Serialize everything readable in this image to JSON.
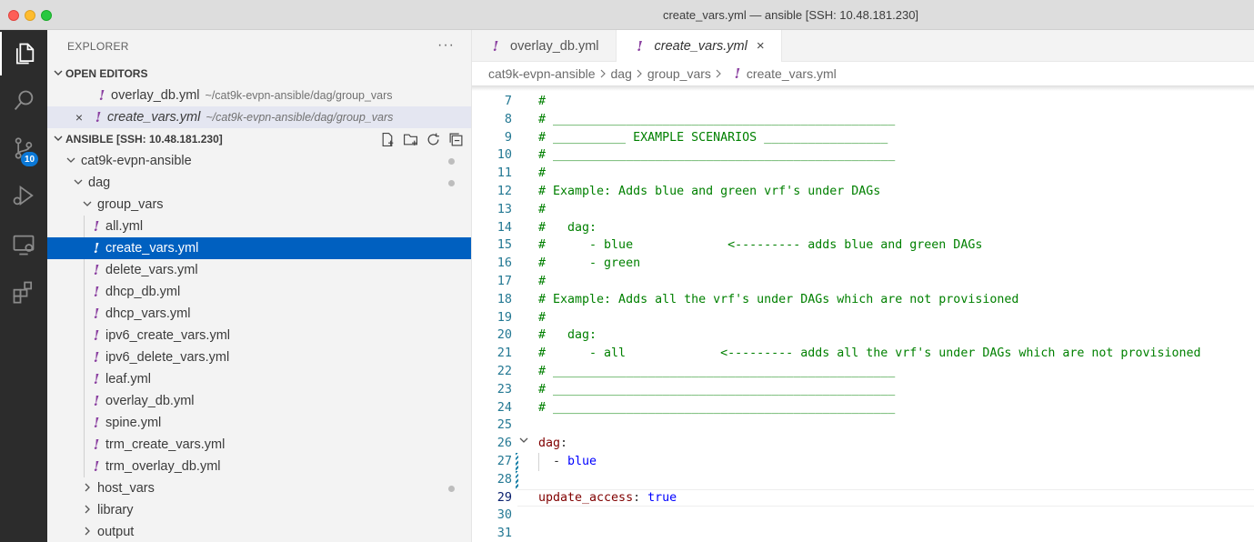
{
  "window": {
    "title": "create_vars.yml — ansible [SSH: 10.48.181.230]"
  },
  "activity_bar": {
    "source_control_badge": "10"
  },
  "sidebar": {
    "header": "EXPLORER",
    "more": "···",
    "open_editors": {
      "label": "OPEN EDITORS",
      "items": [
        {
          "name": "overlay_db.yml",
          "path": "~/cat9k-evpn-ansible/dag/group_vars"
        },
        {
          "name": "create_vars.yml",
          "path": "~/cat9k-evpn-ansible/dag/group_vars",
          "close": "×"
        }
      ]
    },
    "workspace": {
      "label": "ANSIBLE [SSH: 10.48.181.230]",
      "tree": {
        "root": "cat9k-evpn-ansible",
        "dag": "dag",
        "group_vars": "group_vars",
        "files": [
          "all.yml",
          "create_vars.yml",
          "delete_vars.yml",
          "dhcp_db.yml",
          "dhcp_vars.yml",
          "ipv6_create_vars.yml",
          "ipv6_delete_vars.yml",
          "leaf.yml",
          "overlay_db.yml",
          "spine.yml",
          "trm_create_vars.yml",
          "trm_overlay_db.yml"
        ],
        "host_vars": "host_vars",
        "library": "library",
        "output": "output"
      }
    }
  },
  "editor": {
    "tabs": [
      {
        "label": "overlay_db.yml"
      },
      {
        "label": "create_vars.yml",
        "close": "×"
      }
    ],
    "breadcrumbs": [
      "cat9k-evpn-ansible",
      "dag",
      "group_vars",
      "create_vars.yml"
    ],
    "lines": [
      {
        "n": "7",
        "text": "#"
      },
      {
        "n": "8",
        "text": "# _______________________________________________"
      },
      {
        "n": "9",
        "text": "# __________ EXAMPLE SCENARIOS _________________"
      },
      {
        "n": "10",
        "text": "# _______________________________________________"
      },
      {
        "n": "11",
        "text": "#"
      },
      {
        "n": "12",
        "text": "# Example: Adds blue and green vrf's under DAGs"
      },
      {
        "n": "13",
        "text": "#"
      },
      {
        "n": "14",
        "text": "#   dag:"
      },
      {
        "n": "15",
        "text": "#      - blue             <--------- adds blue and green DAGs"
      },
      {
        "n": "16",
        "text": "#      - green"
      },
      {
        "n": "17",
        "text": "#"
      },
      {
        "n": "18",
        "text": "# Example: Adds all the vrf's under DAGs which are not provisioned"
      },
      {
        "n": "19",
        "text": "#"
      },
      {
        "n": "20",
        "text": "#   dag:"
      },
      {
        "n": "21",
        "text": "#      - all             <--------- adds all the vrf's under DAGs which are not provisioned"
      },
      {
        "n": "22",
        "text": "# _______________________________________________"
      },
      {
        "n": "23",
        "text": "# _______________________________________________"
      },
      {
        "n": "24",
        "text": "# _______________________________________________"
      },
      {
        "n": "25",
        "text": ""
      },
      {
        "n": "26",
        "key": "dag",
        "colon": ":"
      },
      {
        "n": "27",
        "dash": "  - ",
        "value": "blue"
      },
      {
        "n": "28",
        "text": ""
      },
      {
        "n": "29",
        "key": "update_access",
        "colon": ": ",
        "value": "true"
      },
      {
        "n": "30",
        "text": ""
      },
      {
        "n": "31",
        "text": ""
      }
    ]
  },
  "colors": {
    "accent": "#0060c0",
    "comment": "#008000",
    "yaml_key": "#800000",
    "yaml_value": "#0000ff",
    "line_number": "#237893",
    "yaml_icon": "#8a3fa0"
  },
  "icons": {
    "activity": [
      "explorer-icon",
      "search-icon",
      "source-control-icon",
      "run-debug-icon",
      "remote-explorer-icon",
      "extensions-icon"
    ],
    "tree_actions": [
      "new-file-icon",
      "new-folder-icon",
      "refresh-icon",
      "collapse-all-icon"
    ]
  }
}
